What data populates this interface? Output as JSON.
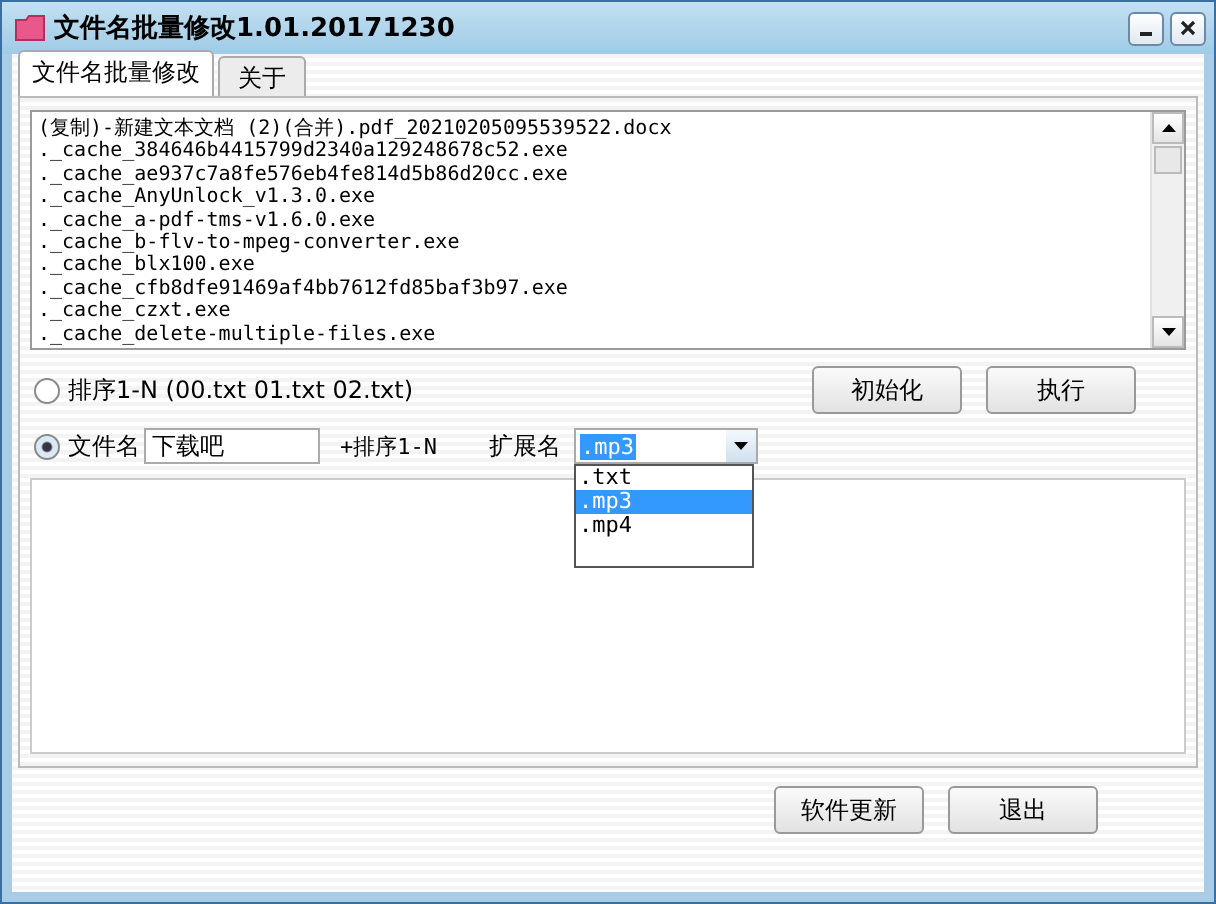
{
  "window": {
    "title": "文件名批量修改1.01.20171230"
  },
  "tabs": [
    {
      "label": "文件名批量修改",
      "selected": true
    },
    {
      "label": "关于",
      "selected": false
    }
  ],
  "file_list": [
    "(复制)-新建文本文档 (2)(合并).pdf_20210205095539522.docx",
    "._cache_384646b4415799d2340a129248678c52.exe",
    "._cache_ae937c7a8fe576eb4fe814d5b86d20cc.exe",
    "._cache_AnyUnlock_v1.3.0.exe",
    "._cache_a-pdf-tms-v1.6.0.exe",
    "._cache_b-flv-to-mpeg-converter.exe",
    "._cache_blx100.exe",
    "._cache_cfb8dfe91469af4bb7612fd85baf3b97.exe",
    "._cache_czxt.exe",
    "._cache_delete-multiple-files.exe"
  ],
  "sequence_option": {
    "label": "排序1-N (00.txt  01.txt 02.txt)",
    "selected": false
  },
  "actions": [
    "初始化",
    "执行"
  ],
  "name_option": {
    "label": "文件名",
    "selected": true,
    "value": "下载吧",
    "suffix": "+排序1-N"
  },
  "extension": {
    "label": "扩展名",
    "value": ".mp3",
    "expanded": true,
    "options": [
      {
        "label": ".txt",
        "selected": false
      },
      {
        "label": ".mp3",
        "selected": true
      },
      {
        "label": ".mp4",
        "selected": false
      }
    ]
  },
  "footer_buttons": [
    "软件更新",
    "退出"
  ]
}
